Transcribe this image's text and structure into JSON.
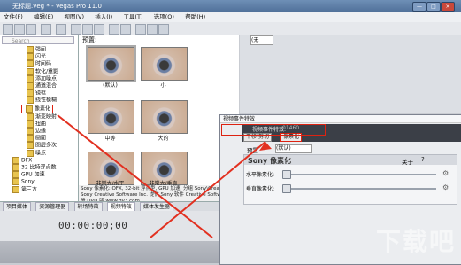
{
  "window": {
    "title": "无标题.veg * - Vegas Pro 11.0",
    "min": "—",
    "max": "□",
    "close": "×"
  },
  "menu": [
    "文件(F)",
    "编辑(E)",
    "视图(V)",
    "插入(I)",
    "工具(T)",
    "选项(O)",
    "帮助(H)"
  ],
  "left_panel": {
    "search_placeholder": "Search",
    "items": [
      "强间",
      "闪光",
      "时间码",
      "软化/重影",
      "添加噪点",
      "通道混合",
      "镜框",
      "线性模糊",
      "像素化",
      "渐变映射",
      "扭曲",
      "边缘",
      "画面",
      "图层多次",
      "噪点",
      "DFX",
      "32 比特浮点数",
      "GPU 加速",
      "Sony",
      "第三方"
    ]
  },
  "presets": {
    "header": "预置:",
    "items": [
      "(默认)",
      "小",
      "中等",
      "大的",
      "非常大/水平",
      "非常大/垂直"
    ],
    "description": "Sony 像素化: OFX, 32-bit 浮点型, GPU 加速, 分组 Sony\\Creative, 由 Sony Creative Software Inc. 提供 Sony 软件 Creative Software 注册 DVD 版 www.dv3.com"
  },
  "tabs": [
    "项目媒体",
    "资源管理器",
    "转场特效",
    "视频特效",
    "媒体发生器"
  ],
  "active_tab": 3,
  "timeline": {
    "time": "00:00:00;00"
  },
  "preview": {
    "select": "(无"
  },
  "dialog": {
    "title": "视频事件特效",
    "chain_label": "视频事件特效:",
    "chain_id": "01460",
    "chip1": "平移/剪切",
    "chip2": "像素化",
    "preset_label": "预置",
    "preset_value": "(默认)",
    "box_title": "Sony 像素化",
    "about": "关于",
    "help": "?",
    "sliders": [
      {
        "label": "水平像素化:",
        "value": 0.0
      },
      {
        "label": "垂直像素化:",
        "value": 0.0
      }
    ]
  },
  "watermark": "下载吧"
}
